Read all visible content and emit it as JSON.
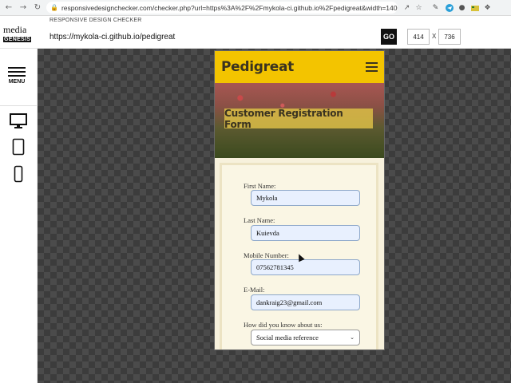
{
  "browser": {
    "url": "responsivedesignchecker.com/checker.php?url=https%3A%2F%2Fmykola-ci.github.io%2Fpedigreat&width=1400&height=7...",
    "icons": [
      "back-icon",
      "forward-icon",
      "reload-icon",
      "lock-icon",
      "share-icon",
      "bookmark-star-icon",
      "pen-extension-icon",
      "telegram-extension-icon",
      "camera-extension-icon",
      "extension-icon",
      "puzzle-extensions-icon"
    ]
  },
  "checker": {
    "label": "RESPONSIVE DESIGN CHECKER",
    "logo_top": "media",
    "logo_bottom": "GENESIS",
    "url_value": "https://mykola-ci.github.io/pedigreat",
    "go_label": "GO",
    "width": "414",
    "height": "736",
    "x_label": "X",
    "menu_label": "MENU",
    "devices": [
      "desktop-icon",
      "tablet-icon",
      "mobile-icon"
    ]
  },
  "site": {
    "brand": "Pedigreat",
    "hero_title": "Customer Registration Form",
    "form": {
      "first_name_label": "First Name:",
      "first_name_value": "Mykola",
      "last_name_label": "Last Name:",
      "last_name_value": "Kuievda",
      "mobile_label": "Mobile Number:",
      "mobile_value": "07562781345",
      "email_label": "E-Mail:",
      "email_value": "dankraig23@gmail.com",
      "source_label": "How did you know about us:",
      "source_value": "Social media reference"
    }
  },
  "colors": {
    "header_yellow": "#f3c400",
    "brand_text": "#3a3320",
    "form_bg": "#faf6e4",
    "autofill_bg": "#e8f0fe"
  }
}
